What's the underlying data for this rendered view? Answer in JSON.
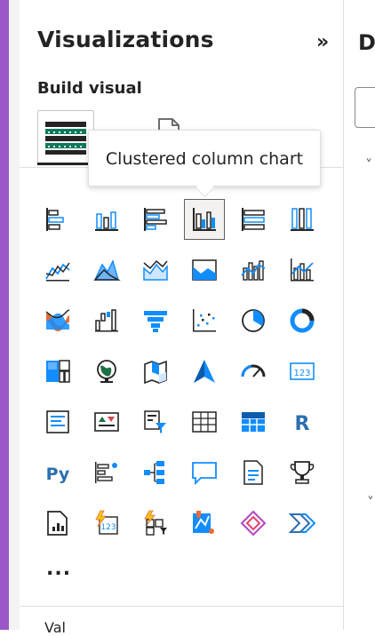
{
  "panel": {
    "title": "Visualizations",
    "collapse_glyph": "»",
    "subtitle": "Build visual",
    "tooltip": "Clustered column chart",
    "more_label": "...",
    "values_peek": "Val"
  },
  "right_panel": {
    "letter": "D",
    "chevron": "˅"
  },
  "colors": {
    "accent_purple": "#9a57c8",
    "icon_blue": "#118dff",
    "icon_dark": "#252423",
    "icon_orange": "#e66c37",
    "icon_green": "#0b7a5c"
  },
  "visuals": [
    {
      "name": "stacked-bar-chart-icon"
    },
    {
      "name": "stacked-column-chart-icon"
    },
    {
      "name": "clustered-bar-chart-icon"
    },
    {
      "name": "clustered-column-chart-icon",
      "selected": true
    },
    {
      "name": "100-percent-stacked-bar-chart-icon"
    },
    {
      "name": "100-percent-stacked-column-chart-icon"
    },
    {
      "name": "line-chart-icon"
    },
    {
      "name": "area-chart-icon"
    },
    {
      "name": "stacked-area-chart-icon"
    },
    {
      "name": "100-percent-stacked-area-chart-icon"
    },
    {
      "name": "line-and-stacked-column-chart-icon"
    },
    {
      "name": "line-and-clustered-column-chart-icon"
    },
    {
      "name": "ribbon-chart-icon"
    },
    {
      "name": "waterfall-chart-icon"
    },
    {
      "name": "funnel-icon"
    },
    {
      "name": "scatter-chart-icon"
    },
    {
      "name": "pie-chart-icon"
    },
    {
      "name": "donut-chart-icon"
    },
    {
      "name": "treemap-icon"
    },
    {
      "name": "map-icon"
    },
    {
      "name": "filled-map-icon"
    },
    {
      "name": "azure-map-icon"
    },
    {
      "name": "gauge-icon"
    },
    {
      "name": "card-icon"
    },
    {
      "name": "multi-row-card-icon"
    },
    {
      "name": "kpi-icon"
    },
    {
      "name": "slicer-icon"
    },
    {
      "name": "table-icon"
    },
    {
      "name": "matrix-icon"
    },
    {
      "name": "r-script-visual-icon"
    },
    {
      "name": "python-visual-icon"
    },
    {
      "name": "key-influencers-icon"
    },
    {
      "name": "decomposition-tree-icon"
    },
    {
      "name": "qa-icon"
    },
    {
      "name": "smart-narrative-icon"
    },
    {
      "name": "metrics-icon"
    },
    {
      "name": "paginated-report-icon"
    },
    {
      "name": "power-automate-icon"
    },
    {
      "name": "power-apps-icon"
    },
    {
      "name": "arcgis-map-icon"
    },
    {
      "name": "power-apps-diamond-icon"
    },
    {
      "name": "power-automate-chevron-icon"
    }
  ]
}
